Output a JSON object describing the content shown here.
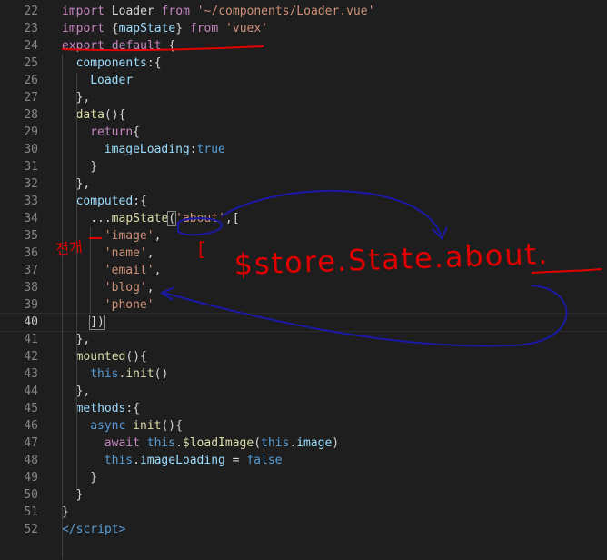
{
  "line_numbers": [
    "22",
    "23",
    "24",
    "25",
    "26",
    "27",
    "28",
    "29",
    "30",
    "31",
    "32",
    "33",
    "34",
    "35",
    "36",
    "37",
    "38",
    "39",
    "40",
    "41",
    "42",
    "43",
    "44",
    "45",
    "46",
    "47",
    "48",
    "49",
    "50",
    "51",
    "52"
  ],
  "current_line": "40",
  "code": {
    "l22": [
      "import",
      " Loader ",
      "from",
      " '~/components/Loader.vue'"
    ],
    "l23": [
      "import",
      " {",
      "mapState",
      "} ",
      "from",
      " 'vuex'"
    ],
    "l24": [
      "export",
      " ",
      "default",
      " {"
    ],
    "l25": [
      "components",
      ":{"
    ],
    "l26": [
      "Loader"
    ],
    "l27": [
      "},"
    ],
    "l28": [
      "data",
      "(){"
    ],
    "l29": [
      "return",
      "{"
    ],
    "l30": [
      "imageLoading",
      ":",
      "true"
    ],
    "l31": [
      "}"
    ],
    "l32": [
      "},"
    ],
    "l33": [
      "computed",
      ":{"
    ],
    "l34": [
      "...",
      "mapState",
      "(",
      "'about'",
      ",["
    ],
    "l35": [
      "'image'",
      ","
    ],
    "l36": [
      "'name'",
      ","
    ],
    "l37": [
      "'email'",
      ","
    ],
    "l38": [
      "'blog'",
      ","
    ],
    "l39": [
      "'phone'"
    ],
    "l40": [
      "])"
    ],
    "l41": [
      "},"
    ],
    "l42": [
      "mounted",
      "(){"
    ],
    "l43": [
      "this",
      ".",
      "init",
      "()"
    ],
    "l44": [
      "},"
    ],
    "l45": [
      "methods",
      ":{"
    ],
    "l46": [
      "async",
      " ",
      "init",
      "(){"
    ],
    "l47": [
      "await",
      " ",
      "this",
      ".",
      "$loadImage",
      "(",
      "this",
      ".",
      "image",
      ")"
    ],
    "l48": [
      "this",
      ".",
      "imageLoading",
      " = ",
      "false"
    ],
    "l49": [
      "}"
    ],
    "l50": [
      "}"
    ],
    "l51": [
      "}"
    ],
    "l52": [
      "</",
      "script",
      ">"
    ]
  },
  "annotations": {
    "korean_note": "전개",
    "bracket_mark": "[",
    "handwritten_text": "$store.State.about.",
    "ink_colors": {
      "red": "#e00000",
      "blue": "#1a1aa6"
    }
  }
}
